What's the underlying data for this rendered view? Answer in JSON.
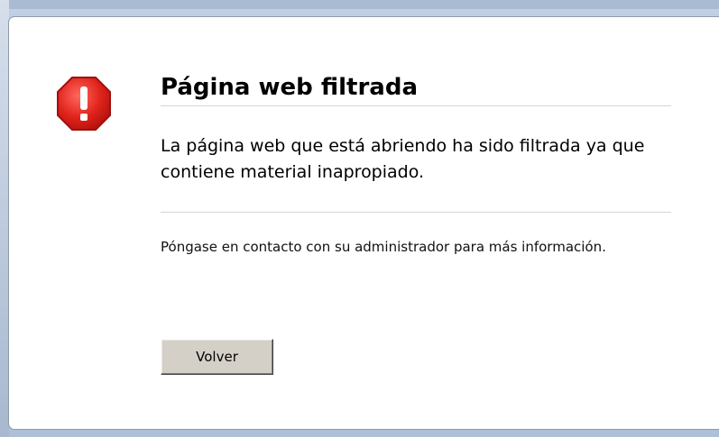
{
  "page": {
    "title": "Página web filtrada",
    "message": "La página web que está abriendo ha sido filtrada ya que contiene material inapropiado.",
    "info": "Póngase en contacto con su administrador para más información.",
    "back_button_label": "Volver",
    "icon": "error-stop-icon",
    "colors": {
      "icon_fill": "#e0231c",
      "icon_border": "#a01010",
      "button_face": "#d4d0c8",
      "rule": "#d4d4d4",
      "panel_background": "#ffffff"
    }
  }
}
